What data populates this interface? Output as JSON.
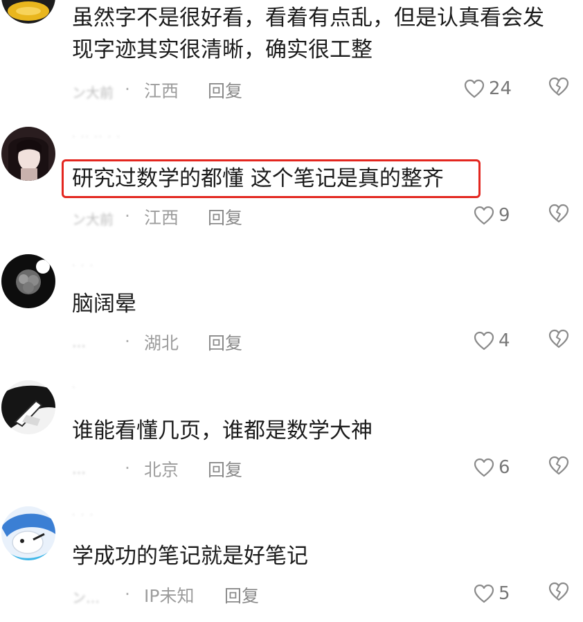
{
  "comments": [
    {
      "lines": [
        "虽然字不是很好看，看着有点乱，但是认真看会发",
        "现字迹其实很清晰，确实很工整"
      ],
      "username": "",
      "meta_name": "ン大前",
      "location": "江西",
      "reply_label": "回复",
      "likes": "24"
    },
    {
      "lines": [
        "研究过数学的都懂 这个笔记是真的整齐"
      ],
      "username": "· ·· ·· · ·",
      "meta_name": "ン大前",
      "location": "江西",
      "reply_label": "回复",
      "likes": "9",
      "highlighted": true
    },
    {
      "lines": [
        "脑阔晕"
      ],
      "username": "· · ·",
      "meta_name": "…",
      "location": "湖北",
      "reply_label": "回复",
      "likes": "4"
    },
    {
      "lines": [
        "谁能看懂几页，谁都是数学大神"
      ],
      "username": "·",
      "meta_name": "…",
      "location": "北京",
      "reply_label": "回复",
      "likes": "6"
    },
    {
      "lines": [
        "学成功的笔记就是好笔记"
      ],
      "username": "· · ·",
      "meta_name": "ン…",
      "location": "IP未知",
      "reply_label": "回复",
      "likes": "5"
    }
  ],
  "colors": {
    "highlight_border": "#e3261f",
    "meta_text": "#9a9a9a",
    "body_text": "#1b1b1b"
  },
  "icons": {
    "like": "heart-outline-icon",
    "dislike": "broken-heart-outline-icon"
  }
}
